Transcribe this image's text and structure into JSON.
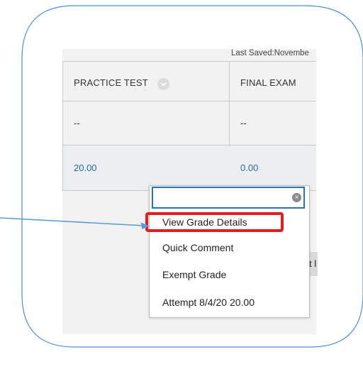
{
  "header": {
    "last_saved": "Last Saved:Novembe"
  },
  "columns": [
    {
      "label": "PRACTICE TEST"
    },
    {
      "label": "FINAL EXAM"
    }
  ],
  "rows": [
    [
      "--",
      "--"
    ],
    [
      "20.00",
      "0.00"
    ]
  ],
  "dropdown": {
    "search_value": "",
    "items": [
      {
        "label": "View Grade Details"
      },
      {
        "label": "Quick Comment"
      },
      {
        "label": "Exempt Grade"
      },
      {
        "label": "Attempt 8/4/20 20.00"
      }
    ]
  },
  "side_button_text": "t l",
  "colors": {
    "link": "#2c6a98",
    "focus_border": "#2574b8",
    "highlight": "#e41e1e",
    "callout_arrow": "#5b9bd5",
    "frame": "#4a90d9"
  }
}
